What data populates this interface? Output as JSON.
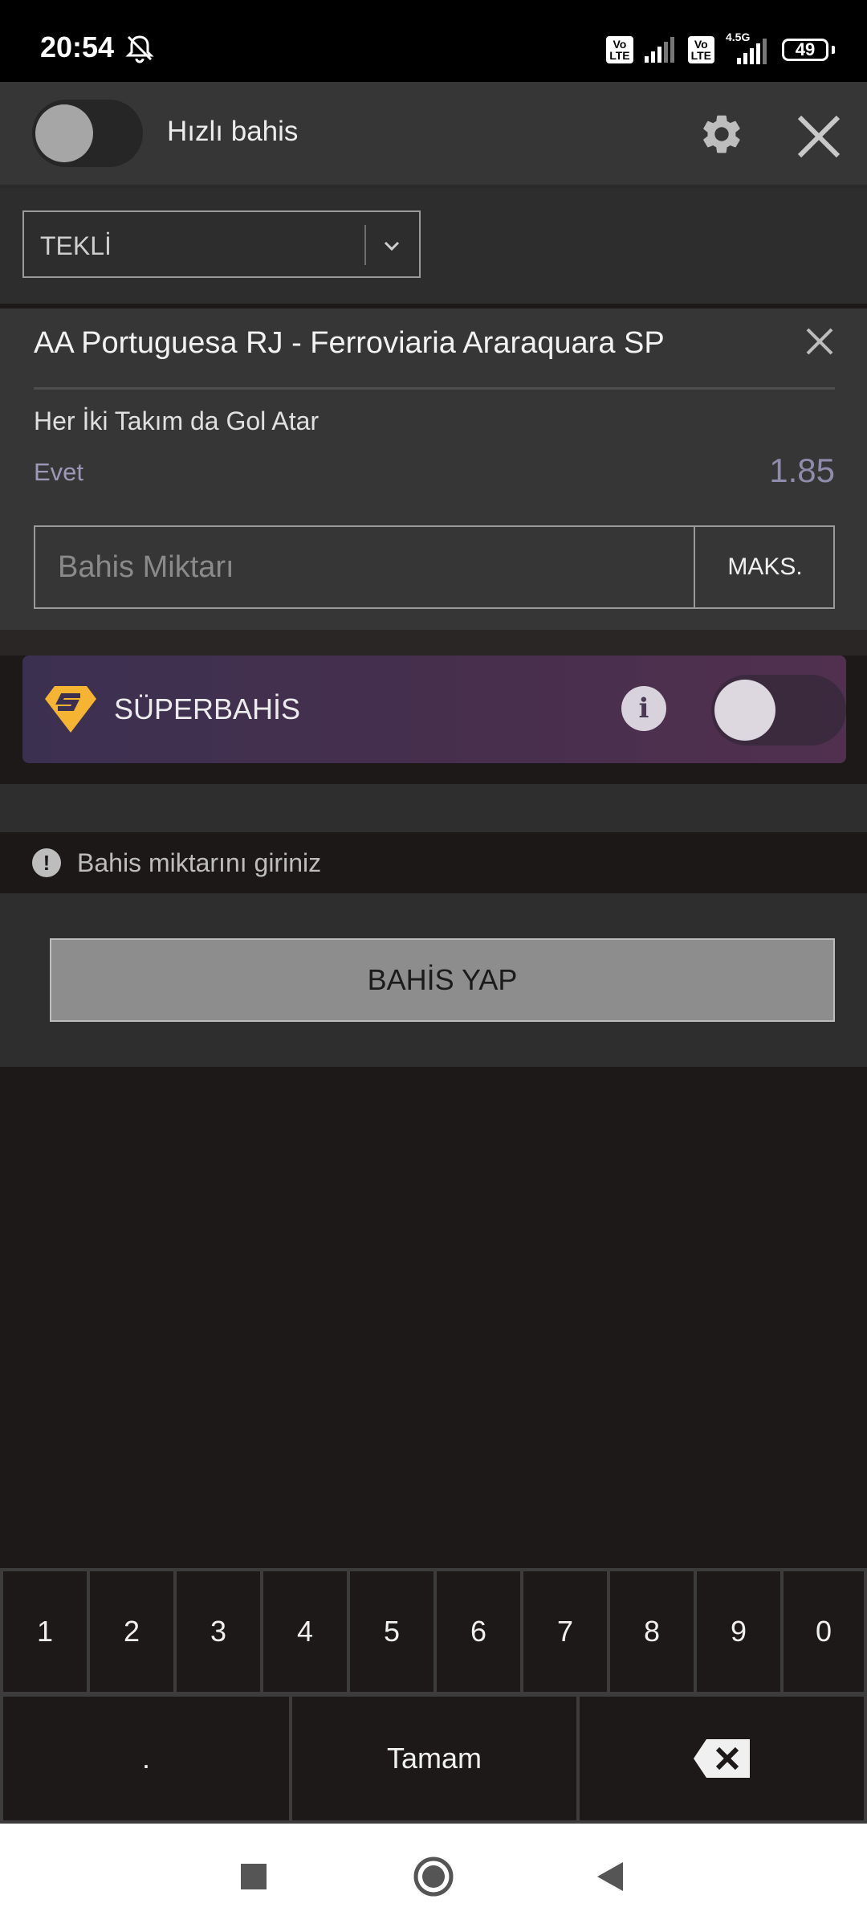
{
  "status_bar": {
    "time": "20:54",
    "battery": "49",
    "network": "4.5G"
  },
  "header": {
    "quick_bet_label": "Hızlı bahis"
  },
  "bet_type": {
    "selected": "TEKLİ"
  },
  "bet": {
    "match": "AA Portuguesa RJ - Ferroviaria Araraquara SP",
    "market": "Her İki Takım da Gol Atar",
    "selection": "Evet",
    "odds": "1.85",
    "stake_placeholder": "Bahis Miktarı",
    "max_label": "MAKS."
  },
  "super": {
    "title": "SÜPERBAHİS"
  },
  "notice": {
    "text": "Bahis miktarını giriniz"
  },
  "actions": {
    "place_bet": "BAHİS YAP"
  },
  "keypad": {
    "digits": [
      "1",
      "2",
      "3",
      "4",
      "5",
      "6",
      "7",
      "8",
      "9",
      "0"
    ],
    "dot": ".",
    "done": "Tamam"
  },
  "colors": {
    "accent_super": "#f5b431",
    "header_bg": "#363636"
  }
}
